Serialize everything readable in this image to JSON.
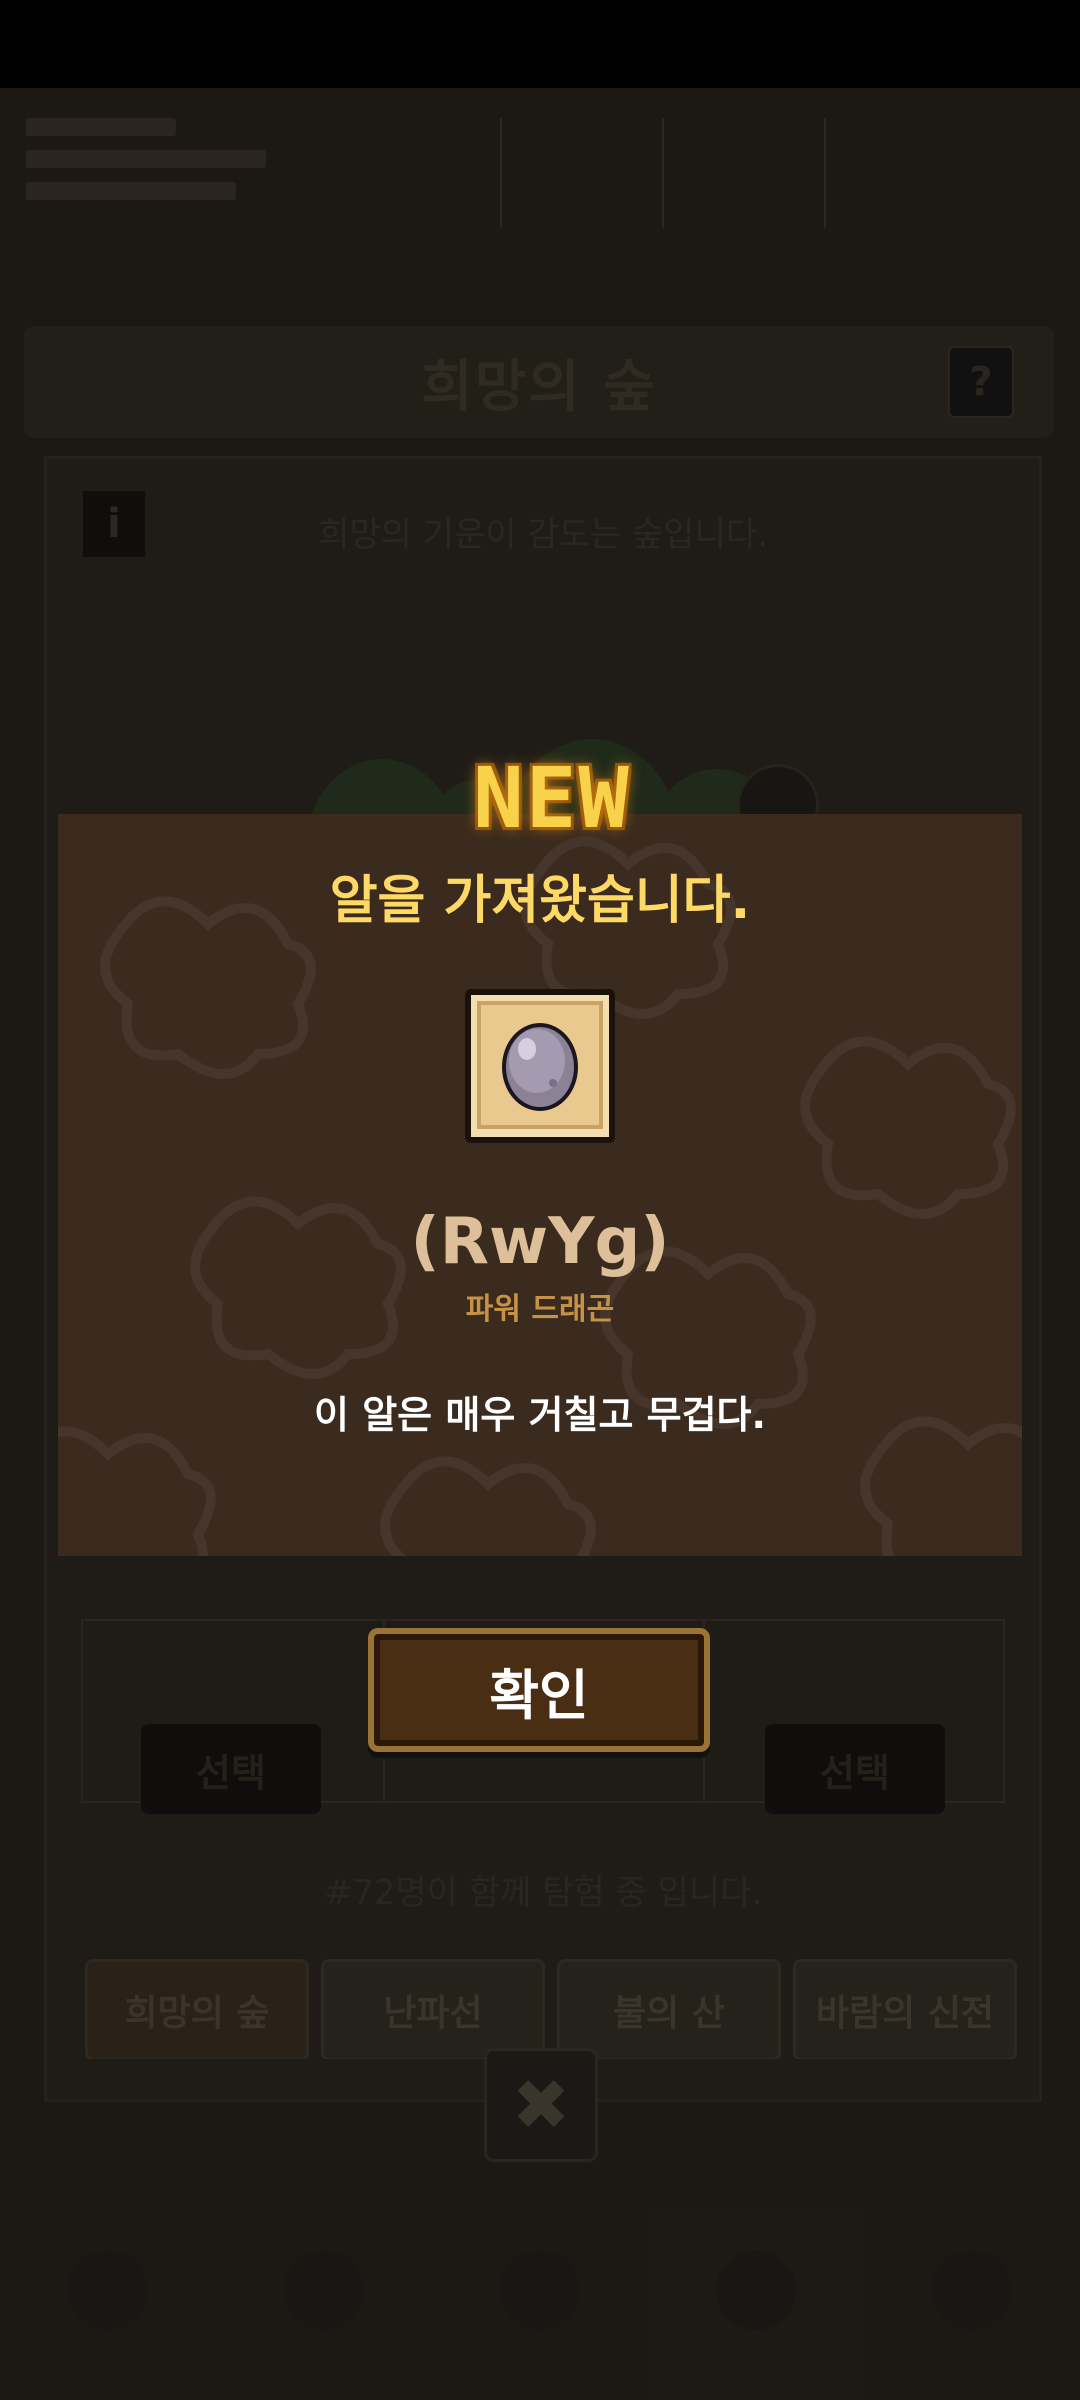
{
  "stage": {
    "title": "희망의 숲",
    "description": "희망의 기운이 감도는 숲입니다.",
    "help_label": "?",
    "info_label": "i",
    "select_labels": [
      "선택",
      "선택"
    ],
    "party_text": "#72명이 함께 탐험 중 입니다.",
    "tabs": [
      "희망의 숲",
      "난파선",
      "불의 산",
      "바람의 신전"
    ],
    "close_label": "✖"
  },
  "modal": {
    "badge": "NEW",
    "title": "알을 가져왔습니다.",
    "egg_name": "(RwYg)",
    "egg_type": "파워 드래곤",
    "description": "이 알은 매우 거칠고 무겁다.",
    "confirm_label": "확인"
  },
  "colors": {
    "modal_bg": "#3b2b1e",
    "title_yellow": "#ffd966",
    "egg_name": "#ddc09a",
    "egg_type": "#c69246",
    "confirm_border": "#9a7434"
  },
  "icons": {
    "egg": "gray-egg-icon",
    "close": "close-icon",
    "help": "help-icon",
    "info": "info-icon"
  }
}
